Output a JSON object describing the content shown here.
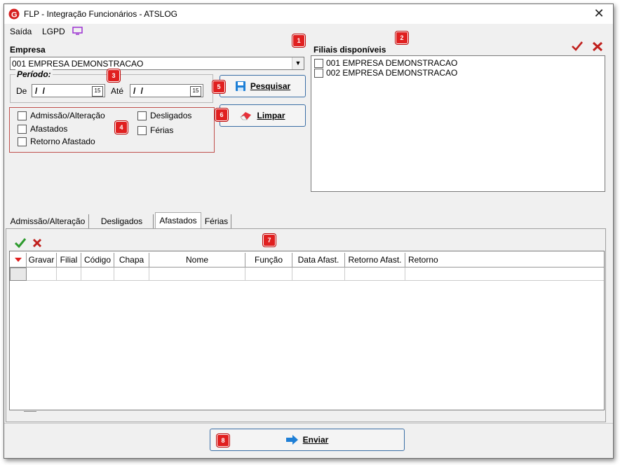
{
  "window": {
    "title": "FLP - Integração Funcionários - ATSLOG"
  },
  "menu": {
    "items": [
      "Saída",
      "LGPD"
    ]
  },
  "empresa": {
    "label": "Empresa",
    "value": "001 EMPRESA DEMONSTRACAO"
  },
  "periodo": {
    "legend": "Período:",
    "de_label": "De",
    "ate_label": "Até",
    "de_value": "/ /",
    "ate_value": "/ /"
  },
  "buttons": {
    "pesquisar": "Pesquisar",
    "limpar": "Limpar",
    "enviar": "Enviar"
  },
  "filters": {
    "admissao": "Admissão/Alteração",
    "afastados": "Afastados",
    "retorno": "Retorno Afastado",
    "desligados": "Desligados",
    "ferias": "Férias"
  },
  "filiais": {
    "label": "Filiais disponíveis",
    "items": [
      "001 EMPRESA DEMONSTRACAO",
      "002 EMPRESA DEMONSTRACAO"
    ]
  },
  "tabs": [
    "Admissão/Alteração",
    "Desligados",
    "Afastados",
    "Férias"
  ],
  "grid": {
    "columns": [
      "Gravar",
      "Filial",
      "Código",
      "Chapa",
      "Nome",
      "Função",
      "Data Afast.",
      "Retorno Afast.",
      "Retorno"
    ]
  },
  "badges": [
    "1",
    "2",
    "3",
    "4",
    "5",
    "6",
    "7",
    "8"
  ],
  "colors": {
    "check_green": "#2e9b2e",
    "cross_red": "#c0201d",
    "badge_red": "#e02020",
    "accent_blue": "#1e7fd6",
    "monitor_purple": "#9b2fd1"
  }
}
